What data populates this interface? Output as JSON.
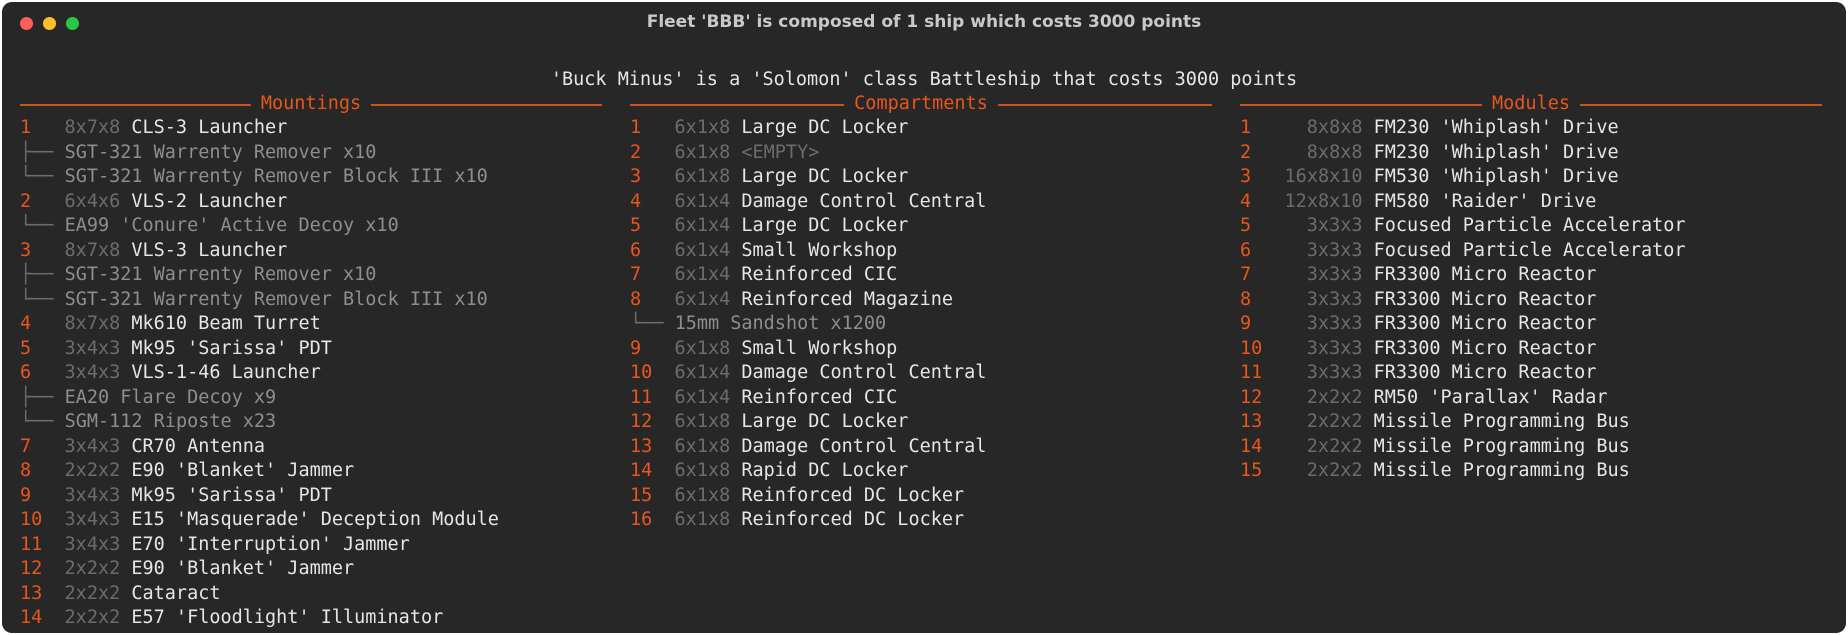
{
  "window": {
    "title": "Fleet 'BBB' is composed of 1 ship which costs 3000 points"
  },
  "ship_title": "'Buck Minus' is a 'Solomon' class Battleship that costs 3000 points",
  "colors": {
    "background": "#272727",
    "accent": "#e8561c",
    "text": "#e6e6e6",
    "muted": "#6c6c6c",
    "sub_item": "#8e8e8e"
  },
  "columns": [
    {
      "header": "Mountings",
      "rows": [
        {
          "kind": "item",
          "num": "1",
          "size": "8x7x8",
          "name": "CLS-3 Launcher"
        },
        {
          "kind": "sub",
          "tree": "├── ",
          "text": "SGT-321 Warrenty Remover x10"
        },
        {
          "kind": "sub",
          "tree": "└── ",
          "text": "SGT-321 Warrenty Remover Block III x10"
        },
        {
          "kind": "item",
          "num": "2",
          "size": "6x4x6",
          "name": "VLS-2 Launcher"
        },
        {
          "kind": "sub",
          "tree": "└── ",
          "text": "EA99 'Conure' Active Decoy x10"
        },
        {
          "kind": "item",
          "num": "3",
          "size": "8x7x8",
          "name": "VLS-3 Launcher"
        },
        {
          "kind": "sub",
          "tree": "├── ",
          "text": "SGT-321 Warrenty Remover x10"
        },
        {
          "kind": "sub",
          "tree": "└── ",
          "text": "SGT-321 Warrenty Remover Block III x10"
        },
        {
          "kind": "item",
          "num": "4",
          "size": "8x7x8",
          "name": "Mk610 Beam Turret"
        },
        {
          "kind": "item",
          "num": "5",
          "size": "3x4x3",
          "name": "Mk95 'Sarissa' PDT"
        },
        {
          "kind": "item",
          "num": "6",
          "size": "3x4x3",
          "name": "VLS-1-46 Launcher"
        },
        {
          "kind": "sub",
          "tree": "├── ",
          "text": "EA20 Flare Decoy x9"
        },
        {
          "kind": "sub",
          "tree": "└── ",
          "text": "SGM-112 Riposte x23"
        },
        {
          "kind": "item",
          "num": "7",
          "size": "3x4x3",
          "name": "CR70 Antenna"
        },
        {
          "kind": "item",
          "num": "8",
          "size": "2x2x2",
          "name": "E90 'Blanket' Jammer"
        },
        {
          "kind": "item",
          "num": "9",
          "size": "3x4x3",
          "name": "Mk95 'Sarissa' PDT"
        },
        {
          "kind": "item",
          "num": "10",
          "size": "3x4x3",
          "name": "E15 'Masquerade' Deception Module"
        },
        {
          "kind": "item",
          "num": "11",
          "size": "3x4x3",
          "name": "E70 'Interruption' Jammer"
        },
        {
          "kind": "item",
          "num": "12",
          "size": "2x2x2",
          "name": "E90 'Blanket' Jammer"
        },
        {
          "kind": "item",
          "num": "13",
          "size": "2x2x2",
          "name": "Cataract"
        },
        {
          "kind": "item",
          "num": "14",
          "size": "2x2x2",
          "name": "E57 'Floodlight' Illuminator"
        }
      ]
    },
    {
      "header": "Compartments",
      "rows": [
        {
          "kind": "item",
          "num": "1",
          "size": "6x1x8",
          "name": "Large DC Locker"
        },
        {
          "kind": "item",
          "num": "2",
          "size": "6x1x8",
          "name": "<EMPTY>",
          "empty": true
        },
        {
          "kind": "item",
          "num": "3",
          "size": "6x1x8",
          "name": "Large DC Locker"
        },
        {
          "kind": "item",
          "num": "4",
          "size": "6x1x4",
          "name": "Damage Control Central"
        },
        {
          "kind": "item",
          "num": "5",
          "size": "6x1x4",
          "name": "Large DC Locker"
        },
        {
          "kind": "item",
          "num": "6",
          "size": "6x1x4",
          "name": "Small Workshop"
        },
        {
          "kind": "item",
          "num": "7",
          "size": "6x1x4",
          "name": "Reinforced CIC"
        },
        {
          "kind": "item",
          "num": "8",
          "size": "6x1x4",
          "name": "Reinforced Magazine"
        },
        {
          "kind": "sub",
          "tree": "└── ",
          "text": "15mm Sandshot x1200"
        },
        {
          "kind": "item",
          "num": "9",
          "size": "6x1x8",
          "name": "Small Workshop"
        },
        {
          "kind": "item",
          "num": "10",
          "size": "6x1x4",
          "name": "Damage Control Central"
        },
        {
          "kind": "item",
          "num": "11",
          "size": "6x1x4",
          "name": "Reinforced CIC"
        },
        {
          "kind": "item",
          "num": "12",
          "size": "6x1x8",
          "name": "Large DC Locker"
        },
        {
          "kind": "item",
          "num": "13",
          "size": "6x1x8",
          "name": "Damage Control Central"
        },
        {
          "kind": "item",
          "num": "14",
          "size": "6x1x8",
          "name": "Rapid DC Locker"
        },
        {
          "kind": "item",
          "num": "15",
          "size": "6x1x8",
          "name": "Reinforced DC Locker"
        },
        {
          "kind": "item",
          "num": "16",
          "size": "6x1x8",
          "name": "Reinforced DC Locker"
        }
      ]
    },
    {
      "header": "Modules",
      "rows": [
        {
          "kind": "item",
          "num": "1",
          "size": "8x8x8",
          "name": "FM230 'Whiplash' Drive"
        },
        {
          "kind": "item",
          "num": "2",
          "size": "8x8x8",
          "name": "FM230 'Whiplash' Drive"
        },
        {
          "kind": "item",
          "num": "3",
          "size": "16x8x10",
          "name": "FM530 'Whiplash' Drive"
        },
        {
          "kind": "item",
          "num": "4",
          "size": "12x8x10",
          "name": "FM580 'Raider' Drive"
        },
        {
          "kind": "item",
          "num": "5",
          "size": "3x3x3",
          "name": "Focused Particle Accelerator"
        },
        {
          "kind": "item",
          "num": "6",
          "size": "3x3x3",
          "name": "Focused Particle Accelerator"
        },
        {
          "kind": "item",
          "num": "7",
          "size": "3x3x3",
          "name": "FR3300 Micro Reactor"
        },
        {
          "kind": "item",
          "num": "8",
          "size": "3x3x3",
          "name": "FR3300 Micro Reactor"
        },
        {
          "kind": "item",
          "num": "9",
          "size": "3x3x3",
          "name": "FR3300 Micro Reactor"
        },
        {
          "kind": "item",
          "num": "10",
          "size": "3x3x3",
          "name": "FR3300 Micro Reactor"
        },
        {
          "kind": "item",
          "num": "11",
          "size": "3x3x3",
          "name": "FR3300 Micro Reactor"
        },
        {
          "kind": "item",
          "num": "12",
          "size": "2x2x2",
          "name": "RM50 'Parallax' Radar"
        },
        {
          "kind": "item",
          "num": "13",
          "size": "2x2x2",
          "name": "Missile Programming Bus"
        },
        {
          "kind": "item",
          "num": "14",
          "size": "2x2x2",
          "name": "Missile Programming Bus"
        },
        {
          "kind": "item",
          "num": "15",
          "size": "2x2x2",
          "name": "Missile Programming Bus"
        }
      ]
    }
  ]
}
